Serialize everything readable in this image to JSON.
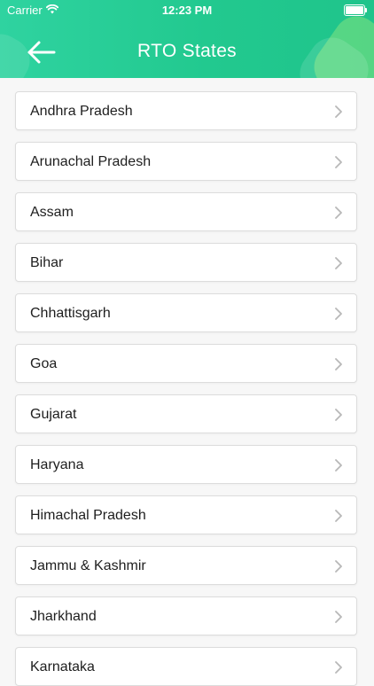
{
  "status_bar": {
    "carrier": "Carrier",
    "time": "12:23 PM"
  },
  "header": {
    "title": "RTO States",
    "back_icon": "arrow-left-icon"
  },
  "states": [
    "Andhra Pradesh",
    "Arunachal Pradesh",
    "Assam",
    "Bihar",
    "Chhattisgarh",
    "Goa",
    "Gujarat",
    "Haryana",
    "Himachal Pradesh",
    "Jammu & Kashmir",
    "Jharkhand",
    "Karnataka"
  ],
  "colors": {
    "header_start": "#2fd3a0",
    "header_end": "#1fc48b",
    "chevron": "#b8b8b8"
  }
}
